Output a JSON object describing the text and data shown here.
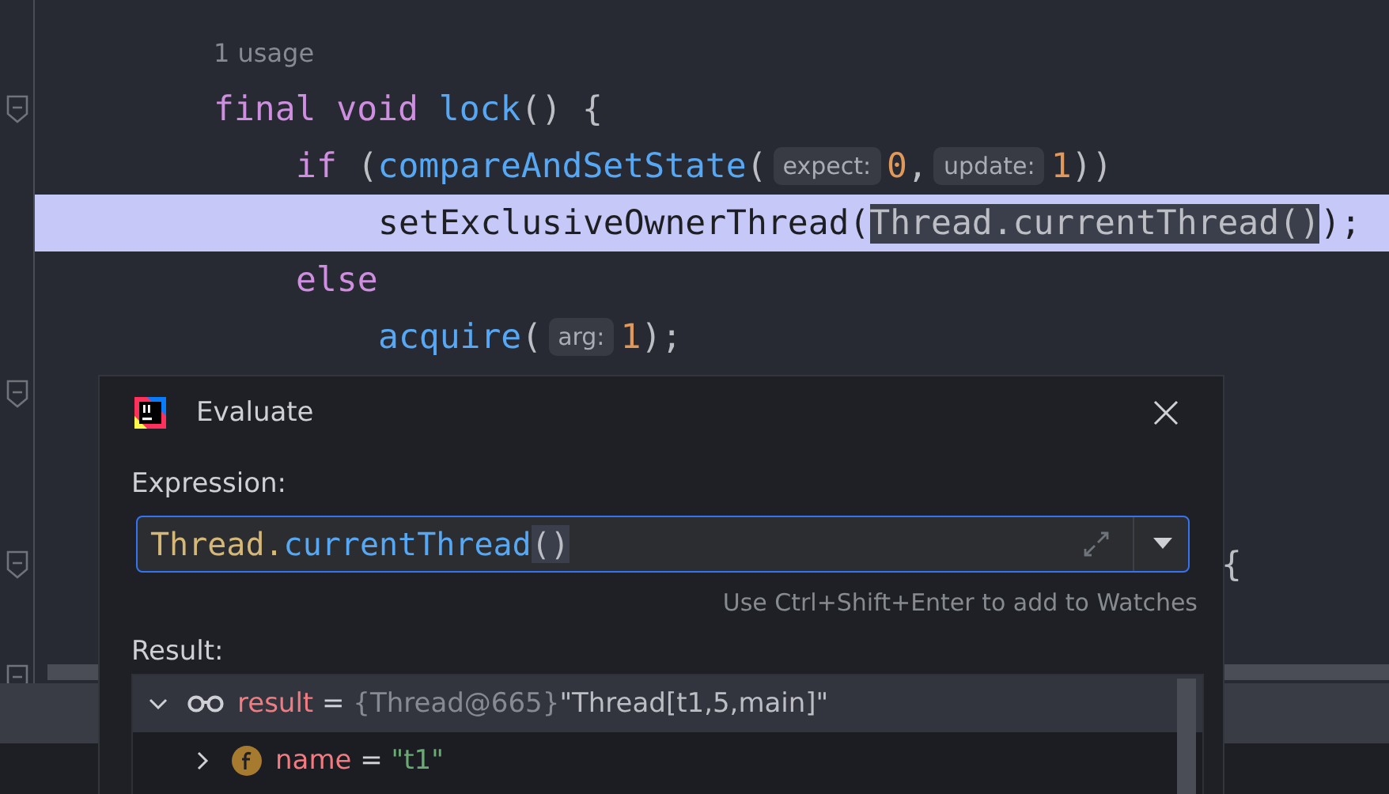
{
  "editor": {
    "lines": [
      {
        "kind": "usage",
        "text": "1 usage"
      },
      {
        "kind": "code",
        "fold": true,
        "tokens": [
          {
            "kind": "keyword",
            "text": "final void "
          },
          {
            "kind": "method",
            "text": "lock"
          },
          {
            "kind": "plain",
            "text": "() {"
          }
        ],
        "children": [
          {
            "kind": "code",
            "tokens": [
              {
                "kind": "keyword",
                "text": "if "
              },
              {
                "kind": "plain",
                "text": "("
              },
              {
                "kind": "method",
                "text": "compareAndSetState"
              },
              {
                "kind": "plain",
                "text": "("
              },
              {
                "kind": "hint",
                "text": "expect:"
              },
              {
                "kind": "number",
                "text": "0"
              },
              {
                "kind": "plain",
                "text": ","
              },
              {
                "kind": "hint",
                "text": "update:"
              },
              {
                "kind": "number",
                "text": "1"
              },
              {
                "kind": "plain",
                "text": "))"
              }
            ],
            "children": [
              {
                "kind": "code",
                "current": true,
                "tokens": [
                  {
                    "kind": "plain",
                    "text": "setExclusiveOwnerThread("
                  },
                  {
                    "kind": "selected",
                    "text": "Thread.currentThread()"
                  },
                  {
                    "kind": "plain",
                    "text": ");"
                  }
                ]
              }
            ]
          },
          {
            "kind": "code",
            "tokens": [
              {
                "kind": "keyword",
                "text": "else"
              }
            ],
            "children": [
              {
                "kind": "code",
                "tokens": [
                  {
                    "kind": "method",
                    "text": "acquire"
                  },
                  {
                    "kind": "plain",
                    "text": "("
                  },
                  {
                    "kind": "hint",
                    "text": "arg:"
                  },
                  {
                    "kind": "number",
                    "text": "1"
                  },
                  {
                    "kind": "plain",
                    "text": ");"
                  }
                ]
              }
            ]
          }
        ]
      },
      {
        "kind": "code",
        "fold": true
      },
      {
        "kind": "code"
      },
      {
        "kind": "code"
      },
      {
        "kind": "code",
        "fold": true,
        "tail": "{"
      },
      {
        "kind": "code"
      },
      {
        "kind": "code",
        "fold": true
      }
    ]
  },
  "dialog": {
    "title": "Evaluate",
    "expression_label": "Expression:",
    "expression": [
      {
        "kind": "class",
        "text": "Thread."
      },
      {
        "kind": "method",
        "text": "currentThread"
      },
      {
        "kind": "selected",
        "text": "()"
      }
    ],
    "hint": "Use Ctrl+Shift+Enter to add to Watches",
    "result_label": "Result:",
    "result": [
      {
        "kind": "watch",
        "expanded": true,
        "selected": true,
        "name": "result",
        "op": "=",
        "type": "{Thread@665}",
        "value": "\"Thread[t1,5,main]\""
      },
      {
        "kind": "field",
        "expanded": false,
        "selected": false,
        "name": "name",
        "op": "=",
        "value": "\"t1\""
      }
    ]
  }
}
